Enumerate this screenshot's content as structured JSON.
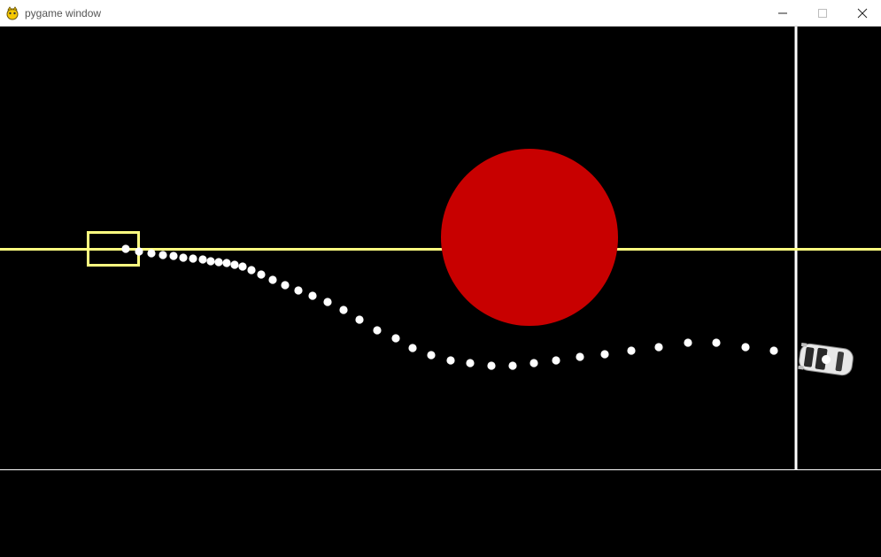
{
  "window": {
    "title": "pygame window",
    "icon": "pygame-icon",
    "controls": [
      "minimize-icon",
      "maximize-icon",
      "close-icon"
    ]
  },
  "colors": {
    "background": "#000000",
    "lane_line": "#ffff80",
    "obstacle": "#c80000",
    "trail_dots": "#ffffff",
    "boundary": "#ffffff",
    "target_box": "#ffff80"
  },
  "scene": {
    "obstacle": "red-circle",
    "target": "yellow-target-box",
    "vehicle": "white-car",
    "trail": "white-dot-path"
  }
}
